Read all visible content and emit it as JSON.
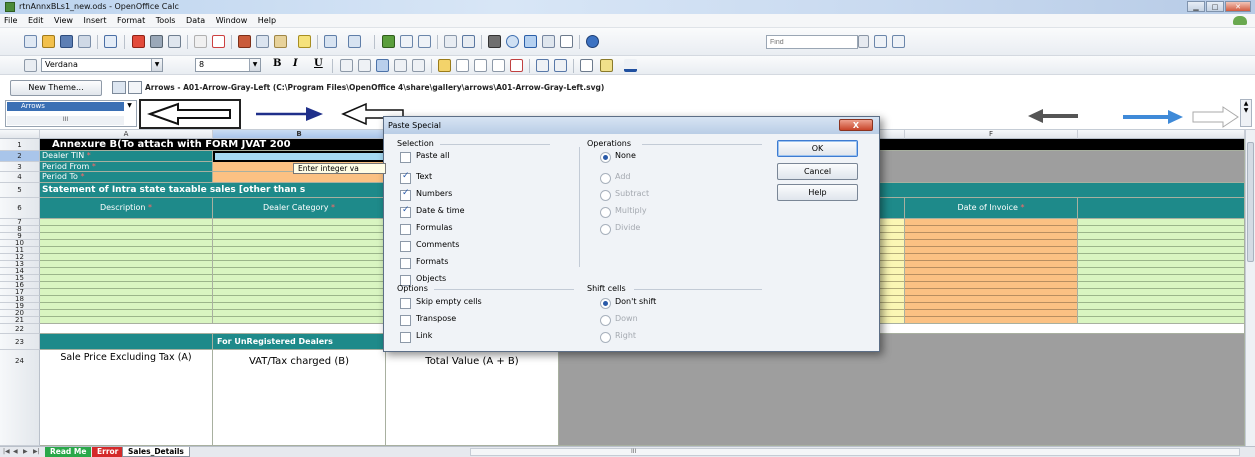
{
  "window": {
    "title": "rtnAnnxBLs1_new.ods - OpenOffice Calc"
  },
  "menu": [
    "File",
    "Edit",
    "View",
    "Insert",
    "Format",
    "Tools",
    "Data",
    "Window",
    "Help"
  ],
  "toolbar": {
    "find_placeholder": "Find"
  },
  "formatting": {
    "font_name": "Verdana",
    "font_size": "8",
    "bold": "B",
    "italic": "I",
    "underline": "U"
  },
  "gallery": {
    "new_theme_label": "New Theme...",
    "theme_selected": "Arrows",
    "path": "Arrows - A01-Arrow-Gray-Left (C:\\Program Files\\OpenOffice 4\\share\\gallery\\arrows\\A01-Arrow-Gray-Left.svg)",
    "scroll_label": "III"
  },
  "sheet": {
    "columns": [
      "A",
      "B",
      "",
      "",
      "",
      "F",
      ""
    ],
    "rows": [
      "1",
      "2",
      "3",
      "4",
      "5",
      "6",
      "7",
      "8",
      "9",
      "10",
      "11",
      "12",
      "13",
      "14",
      "15",
      "16",
      "17",
      "18",
      "19",
      "20",
      "21",
      "22",
      "23",
      "24"
    ],
    "r1": "Annexure B(To attach with FORM JVAT 200",
    "r2": "Dealer TIN",
    "r3": "Period From",
    "r4": "Period To",
    "tooltip": "Enter integer va",
    "r5": "Statement of Intra state taxable sales [other than s",
    "r6_a": "Description",
    "r6_b": "Dealer Category",
    "r6_f": "Date of Invoice",
    "required_mark": "*",
    "r23_b": "For UnRegistered Dealers",
    "r24_a": "Sale Price Excluding Tax (A)",
    "r24_b": "VAT/Tax charged (B)",
    "r24_c": "Total Value (A + B)"
  },
  "tabs": [
    "Read Me",
    "Error",
    "Sales_Details"
  ],
  "hscroll_label": "III",
  "dialog": {
    "title": "Paste Special",
    "close_label": "X",
    "selection_label": "Selection",
    "selection": [
      {
        "label": "Paste all",
        "checked": false
      },
      {
        "label": "Text",
        "checked": true
      },
      {
        "label": "Numbers",
        "checked": true
      },
      {
        "label": "Date & time",
        "checked": true
      },
      {
        "label": "Formulas",
        "checked": false
      },
      {
        "label": "Comments",
        "checked": false
      },
      {
        "label": "Formats",
        "checked": false
      },
      {
        "label": "Objects",
        "checked": false
      }
    ],
    "operations_label": "Operations",
    "operations": [
      {
        "label": "None",
        "selected": true
      },
      {
        "label": "Add",
        "selected": false
      },
      {
        "label": "Subtract",
        "selected": false
      },
      {
        "label": "Multiply",
        "selected": false
      },
      {
        "label": "Divide",
        "selected": false
      }
    ],
    "options_label": "Options",
    "options": [
      {
        "label": "Skip empty cells",
        "checked": false
      },
      {
        "label": "Transpose",
        "checked": false
      },
      {
        "label": "Link",
        "checked": false
      }
    ],
    "shift_label": "Shift cells",
    "shift": [
      {
        "label": "Don't shift",
        "selected": true
      },
      {
        "label": "Down",
        "selected": false
      },
      {
        "label": "Right",
        "selected": false
      }
    ],
    "ok_label": "OK",
    "cancel_label": "Cancel",
    "help_label": "Help"
  },
  "colors": {
    "teal": "#1e8a8a",
    "black_header": "#000000",
    "green": "#d9f5c1",
    "yellow": "#fbf7b4",
    "blue": "#a6d9f2",
    "orange": "#fbc183",
    "grey": "#9e9e9e"
  }
}
